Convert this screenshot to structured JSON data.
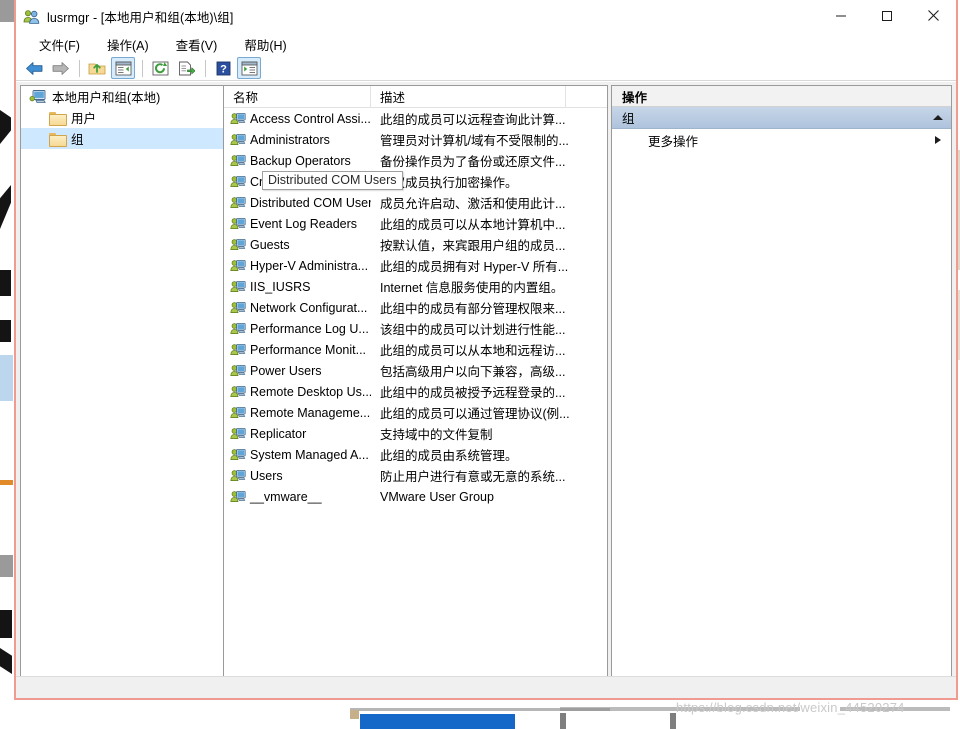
{
  "window": {
    "title": "lusrmgr - [本地用户和组(本地)\\组]",
    "title_icon": "users-group-icon",
    "minimize_label": "最小化",
    "maximize_label": "最大化",
    "close_label": "关闭"
  },
  "menubar": {
    "items": [
      {
        "label": "文件(F)",
        "name": "menu-file"
      },
      {
        "label": "操作(A)",
        "name": "menu-action"
      },
      {
        "label": "查看(V)",
        "name": "menu-view"
      },
      {
        "label": "帮助(H)",
        "name": "menu-help"
      }
    ]
  },
  "toolbar": {
    "buttons": [
      {
        "icon": "back-arrow-icon",
        "label": "后退",
        "toggled": false
      },
      {
        "icon": "forward-arrow-icon",
        "label": "前进",
        "toggled": false
      },
      {
        "icon": "up-folder-icon",
        "label": "向上一级",
        "toggled": false
      },
      {
        "icon": "show-hide-tree-icon",
        "label": "显示/隐藏控制台树",
        "toggled": true
      },
      {
        "icon": "refresh-icon",
        "label": "刷新",
        "toggled": false
      },
      {
        "icon": "export-list-icon",
        "label": "导出列表",
        "toggled": false
      },
      {
        "icon": "help-icon",
        "label": "帮助",
        "toggled": false
      },
      {
        "icon": "show-action-pane-icon",
        "label": "显示/隐藏操作窗格",
        "toggled": true
      }
    ]
  },
  "tree": {
    "root": {
      "label": "本地用户和组(本地)",
      "icon": "computer-icon"
    },
    "children": [
      {
        "label": "用户",
        "icon": "folder-icon",
        "selected": false
      },
      {
        "label": "组",
        "icon": "folder-icon",
        "selected": true
      }
    ]
  },
  "list": {
    "columns": [
      {
        "label": "名称",
        "name": "column-name"
      },
      {
        "label": "描述",
        "name": "column-description"
      }
    ],
    "rows": [
      {
        "name": "Access Control Assi...",
        "description": "此组的成员可以远程查询此计算..."
      },
      {
        "name": "Administrators",
        "description": "管理员对计算机/域有不受限制的..."
      },
      {
        "name": "Backup Operators",
        "description": "备份操作员为了备份或还原文件..."
      },
      {
        "name": "Cryptographic Oper...",
        "description": "授权成员执行加密操作。"
      },
      {
        "name": "Distributed COM Users",
        "description": "成员允许启动、激活和使用此计..."
      },
      {
        "name": "Event Log Readers",
        "description": "此组的成员可以从本地计算机中..."
      },
      {
        "name": "Guests",
        "description": "按默认值，来宾跟用户组的成员..."
      },
      {
        "name": "Hyper-V Administra...",
        "description": "此组的成员拥有对 Hyper-V 所有..."
      },
      {
        "name": "IIS_IUSRS",
        "description": "Internet 信息服务使用的内置组。"
      },
      {
        "name": "Network Configurat...",
        "description": "此组中的成员有部分管理权限来..."
      },
      {
        "name": "Performance Log U...",
        "description": "该组中的成员可以计划进行性能..."
      },
      {
        "name": "Performance Monit...",
        "description": "此组的成员可以从本地和远程访..."
      },
      {
        "name": "Power Users",
        "description": "包括高级用户以向下兼容，高级..."
      },
      {
        "name": "Remote Desktop Us...",
        "description": "此组中的成员被授予远程登录的..."
      },
      {
        "name": "Remote Manageme...",
        "description": "此组的成员可以通过管理协议(例..."
      },
      {
        "name": "Replicator",
        "description": "支持域中的文件复制"
      },
      {
        "name": "System Managed A...",
        "description": "此组的成员由系统管理。"
      },
      {
        "name": "Users",
        "description": "防止用户进行有意或无意的系统..."
      },
      {
        "name": "__vmware__",
        "description": "VMware User Group"
      }
    ]
  },
  "tooltip": {
    "text": "Distributed COM Users"
  },
  "actions": {
    "title": "操作",
    "group_header": "组",
    "items": [
      {
        "label": "更多操作",
        "has_submenu": true
      }
    ]
  },
  "watermark": {
    "text": "https://blog.csdn.net/weixin_44520274"
  },
  "colors": {
    "window_border": "#f09a90",
    "selection": "#cde8ff",
    "action_header": "#aec3dd",
    "toolbar_toggle": "#d6ebfb",
    "watermark": "#c9c9c9"
  }
}
